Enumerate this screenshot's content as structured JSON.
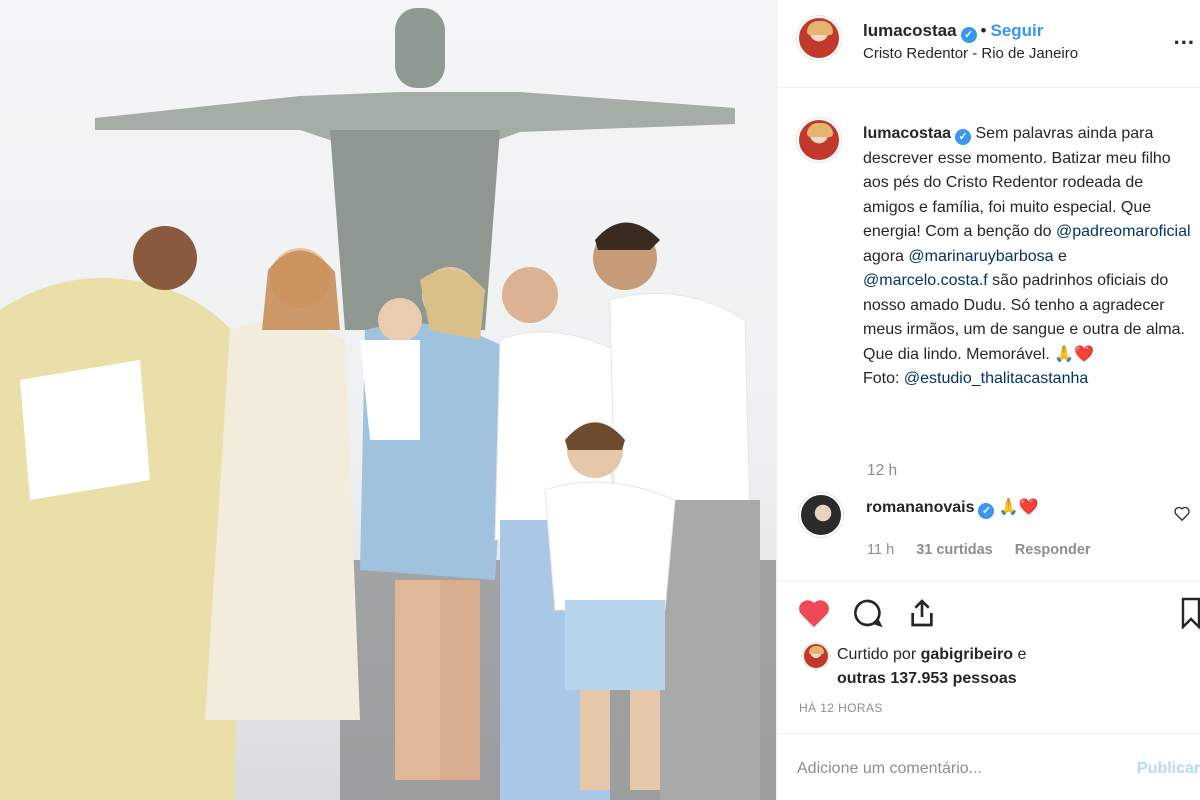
{
  "post": {
    "username": "lumacostaa",
    "follow_label": "Seguir",
    "separator": "•",
    "location": "Cristo Redentor - Rio de Janeiro",
    "more_label": "...",
    "verified_mark": "✓"
  },
  "caption": {
    "username": "lumacostaa",
    "text_1": " Sem palavras ainda para descrever esse momento. Batizar meu filho aos pés do Cristo Redentor rodeada de amigos e família, foi muito especial. Que energia! Com a benção do ",
    "mention_1": "@padreomaroficial",
    "text_2": " agora ",
    "mention_2": "@marinaruybarbosa",
    "text_3": " e ",
    "mention_3": "@marcelo.costa.f",
    "text_4": " são padrinhos oficiais do nosso amado Dudu. Só tenho a agradecer meus irmãos, um de sangue e outra de alma. Que dia lindo. Memorável. 🙏❤️",
    "photo_credit_label": "Foto: ",
    "mention_4": "@estudio_thalitacastanha",
    "time": "12 h"
  },
  "comment": {
    "username": "romananovais",
    "text": " 🙏❤️",
    "time": "11 h",
    "likes": "31 curtidas",
    "reply_label": "Responder"
  },
  "likes": {
    "prefix": "Curtido por ",
    "user": "gabigribeiro",
    "middle": " e",
    "others": "outras 137.953 pessoas"
  },
  "timestamp": "HÁ 12 HORAS",
  "comment_input": {
    "placeholder": "Adicione um comentário...",
    "value": ""
  },
  "publish_label": "Publicar",
  "colors": {
    "accent": "#3897f0",
    "heart": "#ed4956",
    "mention": "#003569",
    "muted": "#8e8e8e"
  }
}
